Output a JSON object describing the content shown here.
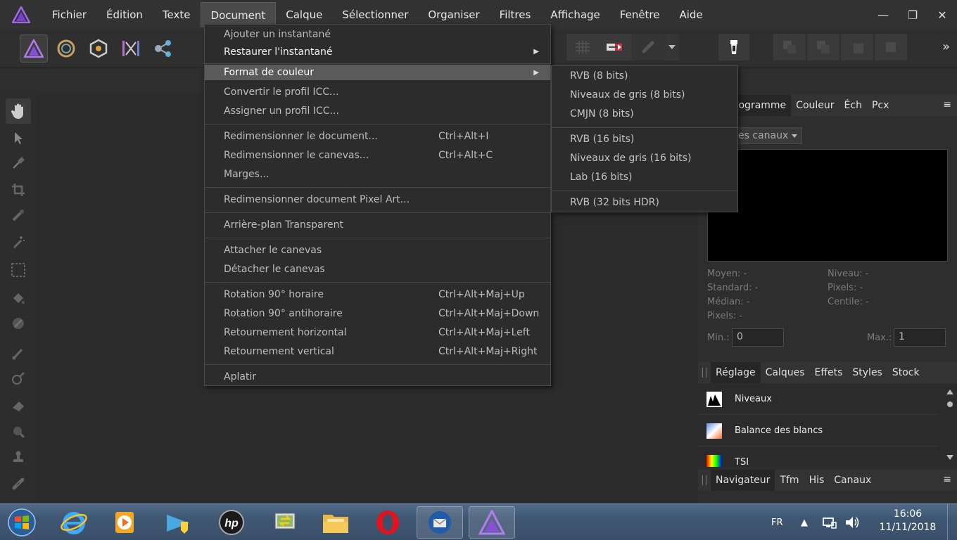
{
  "menubar": {
    "items": [
      "Fichier",
      "Édition",
      "Texte",
      "Document",
      "Calque",
      "Sélectionner",
      "Organiser",
      "Filtres",
      "Affichage",
      "Fenêtre",
      "Aide"
    ],
    "active_index": 3
  },
  "document_menu": {
    "items": [
      {
        "label": "Ajouter un instantané",
        "shortcut": ""
      },
      {
        "label": "Restaurer l'instantané",
        "shortcut": ""
      },
      {
        "label": "Format de couleur",
        "shortcut": ""
      },
      {
        "label": "Convertir le profil ICC...",
        "shortcut": ""
      },
      {
        "label": "Assigner un profil ICC...",
        "shortcut": ""
      },
      {
        "label": "Redimensionner le document...",
        "shortcut": "Ctrl+Alt+I"
      },
      {
        "label": "Redimensionner le canevas...",
        "shortcut": "Ctrl+Alt+C"
      },
      {
        "label": "Marges...",
        "shortcut": ""
      },
      {
        "label": "Redimensionner document Pixel Art...",
        "shortcut": ""
      },
      {
        "label": "Arrière-plan Transparent",
        "shortcut": ""
      },
      {
        "label": "Attacher le canevas",
        "shortcut": ""
      },
      {
        "label": "Détacher le canevas",
        "shortcut": ""
      },
      {
        "label": "Rotation 90° horaire",
        "shortcut": "Ctrl+Alt+Maj+Up"
      },
      {
        "label": "Rotation 90° antihoraire",
        "shortcut": "Ctrl+Alt+Maj+Down"
      },
      {
        "label": "Retournement horizontal",
        "shortcut": "Ctrl+Alt+Maj+Left"
      },
      {
        "label": "Retournement vertical",
        "shortcut": "Ctrl+Alt+Maj+Right"
      },
      {
        "label": "Aplatir",
        "shortcut": ""
      }
    ],
    "highlighted": "Format de couleur"
  },
  "color_format_submenu": {
    "items": [
      "RVB (8 bits)",
      "Niveaux de gris (8 bits)",
      "CMJN (8 bits)",
      "RVB (16 bits)",
      "Niveaux de gris (16 bits)",
      "Lab (16 bits)",
      "RVB (32 bits HDR)"
    ]
  },
  "histogram_panel": {
    "tabs": [
      "togramme",
      "Couleur",
      "Éch",
      "Pcx"
    ],
    "channel_select": "es canaux",
    "stats_left": [
      "Moyen: -",
      "Standard: -",
      "Médian: -",
      "Pixels: -"
    ],
    "stats_right": [
      "Niveau: -",
      "Pixels: -",
      "Centile: -"
    ],
    "min_label": "Min.:",
    "min_value": "0",
    "max_label": "Max.:",
    "max_value": "1"
  },
  "adjust_panel": {
    "tabs": [
      "Réglage",
      "Calques",
      "Effets",
      "Styles",
      "Stock"
    ],
    "items": [
      "Niveaux",
      "Balance des blancs",
      "TSI"
    ]
  },
  "navigator_panel": {
    "tabs": [
      "Navigateur",
      "Tfm",
      "His",
      "Canaux"
    ]
  },
  "taskbar": {
    "lang": "FR",
    "time": "16:06",
    "date": "11/11/2018"
  },
  "toolbar": {
    "overflow": "»"
  },
  "colors": {
    "affinity_purple": "#8a4fd8",
    "menu_highlight": "#5a5a5a"
  }
}
